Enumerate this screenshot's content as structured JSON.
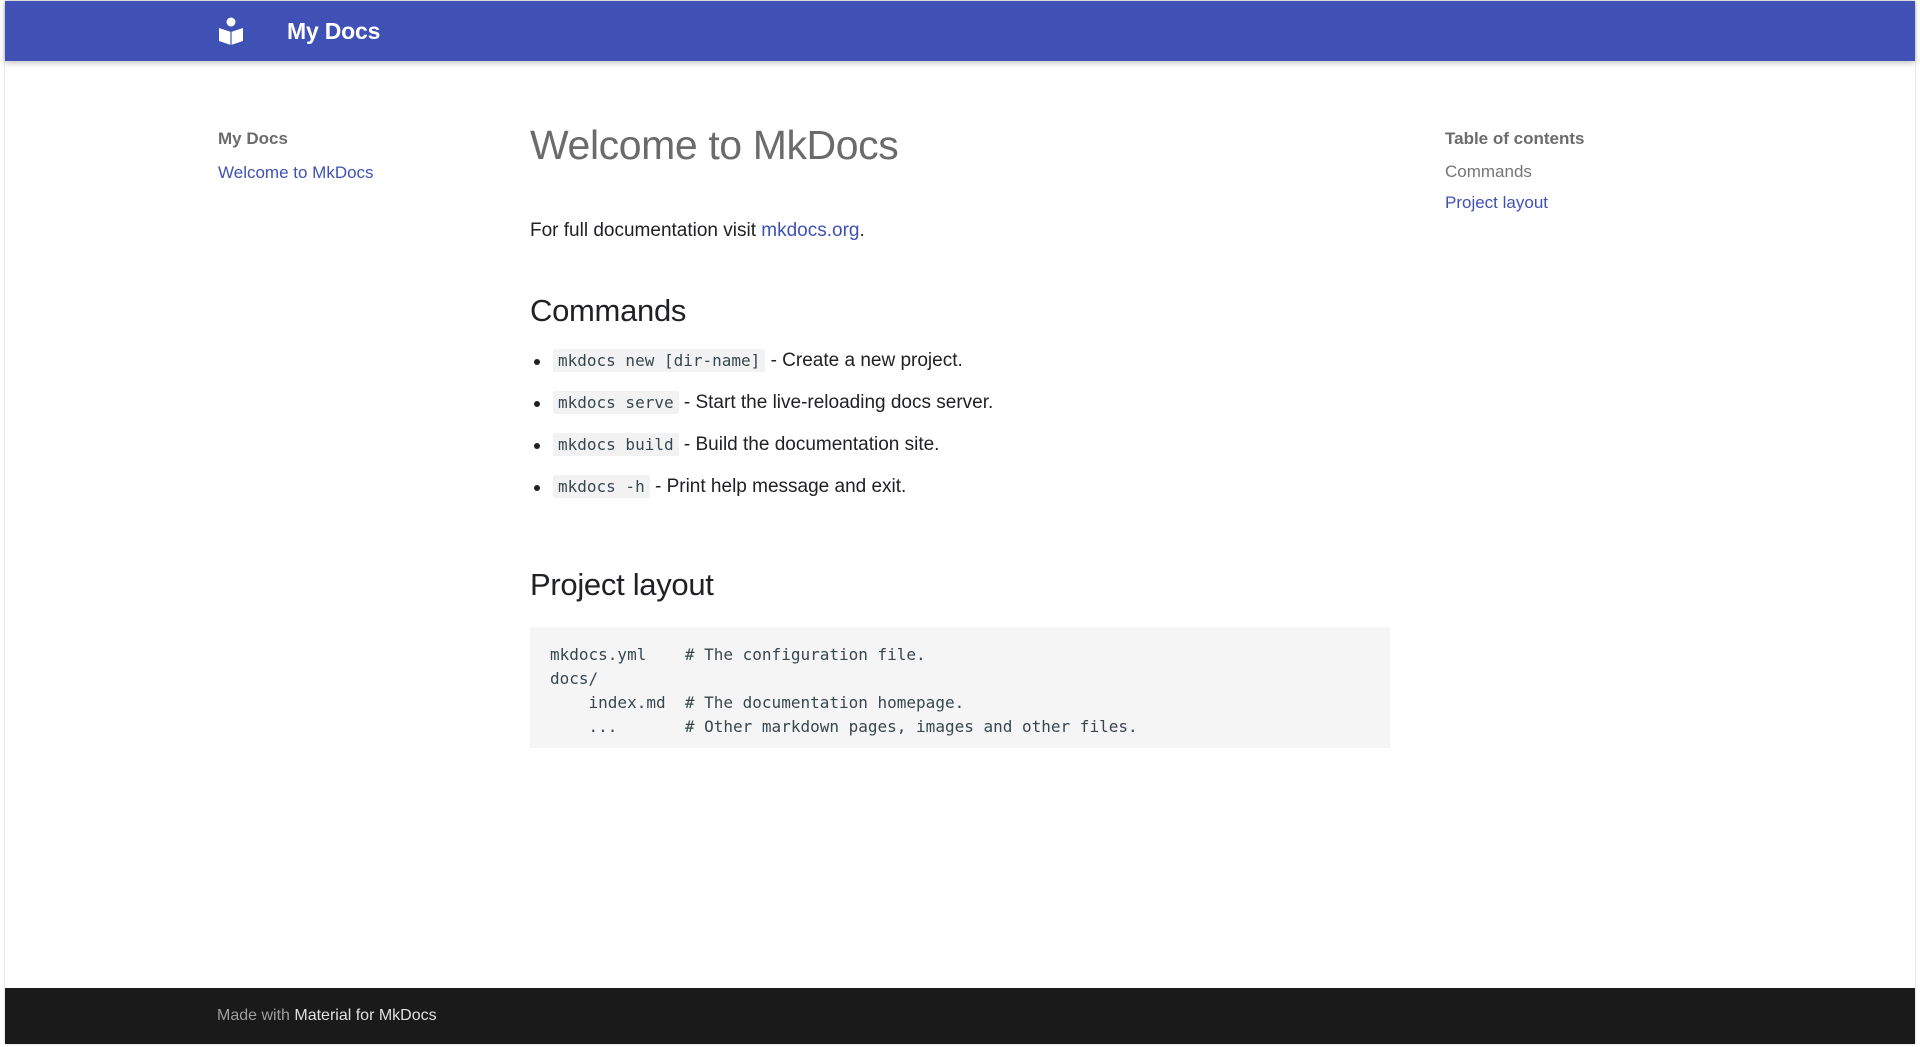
{
  "header": {
    "logo_icon": "book-reader-icon",
    "site_title": "My Docs",
    "bg_color": "#3f51b5"
  },
  "nav": {
    "title": "My Docs",
    "items": [
      {
        "label": "Welcome to MkDocs"
      }
    ]
  },
  "content": {
    "title": "Welcome to MkDocs",
    "intro_prefix": "For full documentation visit ",
    "intro_link": "mkdocs.org",
    "intro_suffix": ".",
    "commands_heading": "Commands",
    "commands": [
      {
        "code": "mkdocs new [dir-name]",
        "text": " - Create a new project."
      },
      {
        "code": "mkdocs serve",
        "text": " - Start the live-reloading docs server."
      },
      {
        "code": "mkdocs build",
        "text": " - Build the documentation site."
      },
      {
        "code": "mkdocs -h",
        "text": " - Print help message and exit."
      }
    ],
    "layout_heading": "Project layout",
    "layout_code": "mkdocs.yml    # The configuration file.\ndocs/\n    index.md  # The documentation homepage.\n    ...       # Other markdown pages, images and other files."
  },
  "toc": {
    "title": "Table of contents",
    "items": [
      {
        "label": "Commands"
      },
      {
        "label": "Project layout"
      }
    ]
  },
  "footer": {
    "prefix": "Made with ",
    "link": "Material for MkDocs"
  },
  "colors": {
    "accent": "#3f51b5",
    "footer_bg": "#1a1a1a"
  }
}
